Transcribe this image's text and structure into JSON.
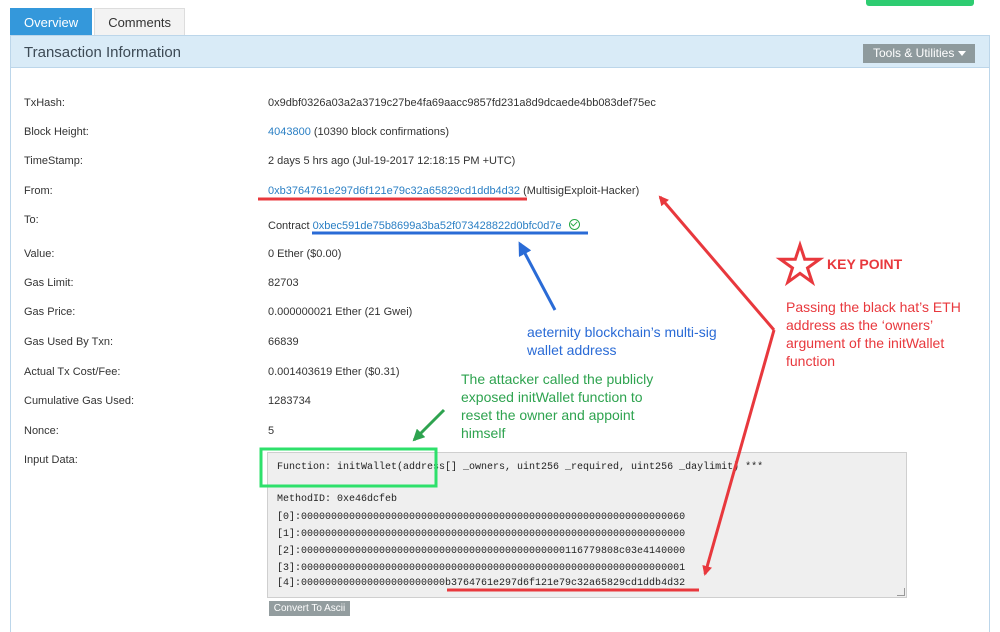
{
  "tabs": [
    {
      "label": "Overview",
      "active": true
    },
    {
      "label": "Comments",
      "active": false
    }
  ],
  "panel": {
    "title": "Transaction Information",
    "tools_label": "Tools & Utilities"
  },
  "rows": {
    "txhash": {
      "label": "TxHash:",
      "value": "0x9dbf0326a03a2a3719c27be4fa69aacc9857fd231a8d9dcaede4bb083def75ec"
    },
    "block_height": {
      "label": "Block Height:",
      "link": "4043800",
      "suffix": "(10390 block confirmations)"
    },
    "timestamp": {
      "label": "TimeStamp:",
      "value": "2 days 5 hrs ago (Jul-19-2017 12:18:15 PM +UTC)"
    },
    "from": {
      "label": "From:",
      "link": "0xb3764761e297d6f121e79c32a65829cd1ddb4d32",
      "suffix": "(MultisigExploit-Hacker)"
    },
    "to": {
      "label": "To:",
      "prefix": "Contract",
      "link": "0xbec591de75b8699a3ba52f073428822d0bfc0d7e"
    },
    "value": {
      "label": "Value:",
      "value": "0 Ether ($0.00)"
    },
    "gas_limit": {
      "label": "Gas Limit:",
      "value": "82703"
    },
    "gas_price": {
      "label": "Gas Price:",
      "value": "0.000000021 Ether (21 Gwei)"
    },
    "gas_used": {
      "label": "Gas Used By Txn:",
      "value": "66839"
    },
    "cost": {
      "label": "Actual Tx Cost/Fee:",
      "value": "0.001403619 Ether ($0.31)"
    },
    "cumulative": {
      "label": "Cumulative Gas Used:",
      "value": "1283734"
    },
    "nonce": {
      "label": "Nonce:",
      "value": "5"
    },
    "input": {
      "label": "Input Data:"
    }
  },
  "input_data": {
    "function": "Function: initWallet(address[] _owners, uint256 _required, uint256 _daylimit) ***",
    "method_id": "MethodID: 0xe46dcfeb",
    "params": [
      "[0]:0000000000000000000000000000000000000000000000000000000000000060",
      "[1]:0000000000000000000000000000000000000000000000000000000000000000",
      "[2]:00000000000000000000000000000000000000000000116779808c03e4140000",
      "[3]:0000000000000000000000000000000000000000000000000000000000000001",
      "[4]:000000000000000000000000b3764761e297d6f121e79c32a65829cd1ddb4d32"
    ],
    "convert_label": "Convert To Ascii"
  },
  "annotations": {
    "key_point": "KEY POINT",
    "red_text": [
      "Passing the black hat’s ETH",
      "address  as the ‘owners’",
      "argument of the initWallet",
      "function"
    ],
    "blue_text": [
      "aeternity blockchain’s multi-sig",
      "wallet address"
    ],
    "green_text": [
      "The attacker called the publicly",
      "exposed initWallet function to",
      "reset the owner and appoint",
      "himself"
    ]
  },
  "colors": {
    "accent": "#3498db",
    "red": "#e8383d",
    "blue": "#2a6bd6",
    "green": "#2ea34f",
    "highlight_green": "#2ee06b"
  }
}
